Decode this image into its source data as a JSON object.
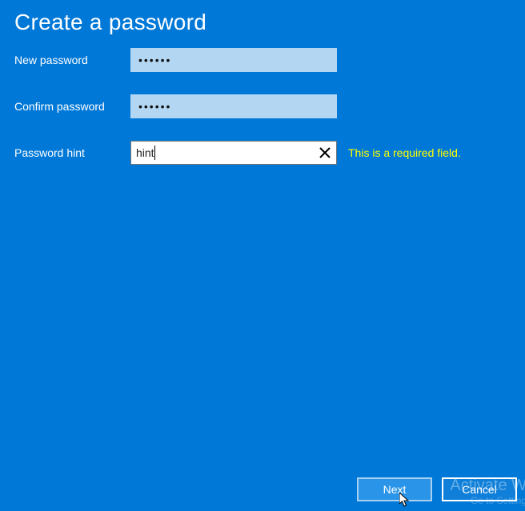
{
  "title": "Create a password",
  "fields": {
    "new_password": {
      "label": "New password",
      "value": "••••••"
    },
    "confirm_password": {
      "label": "Confirm password",
      "value": "••••••"
    },
    "password_hint": {
      "label": "Password hint",
      "value": "hint",
      "message": "This is a required field."
    }
  },
  "buttons": {
    "next": "Next",
    "cancel": "Cancel"
  },
  "watermark": {
    "line1": "Activate W",
    "line2": "Go to Setting"
  }
}
